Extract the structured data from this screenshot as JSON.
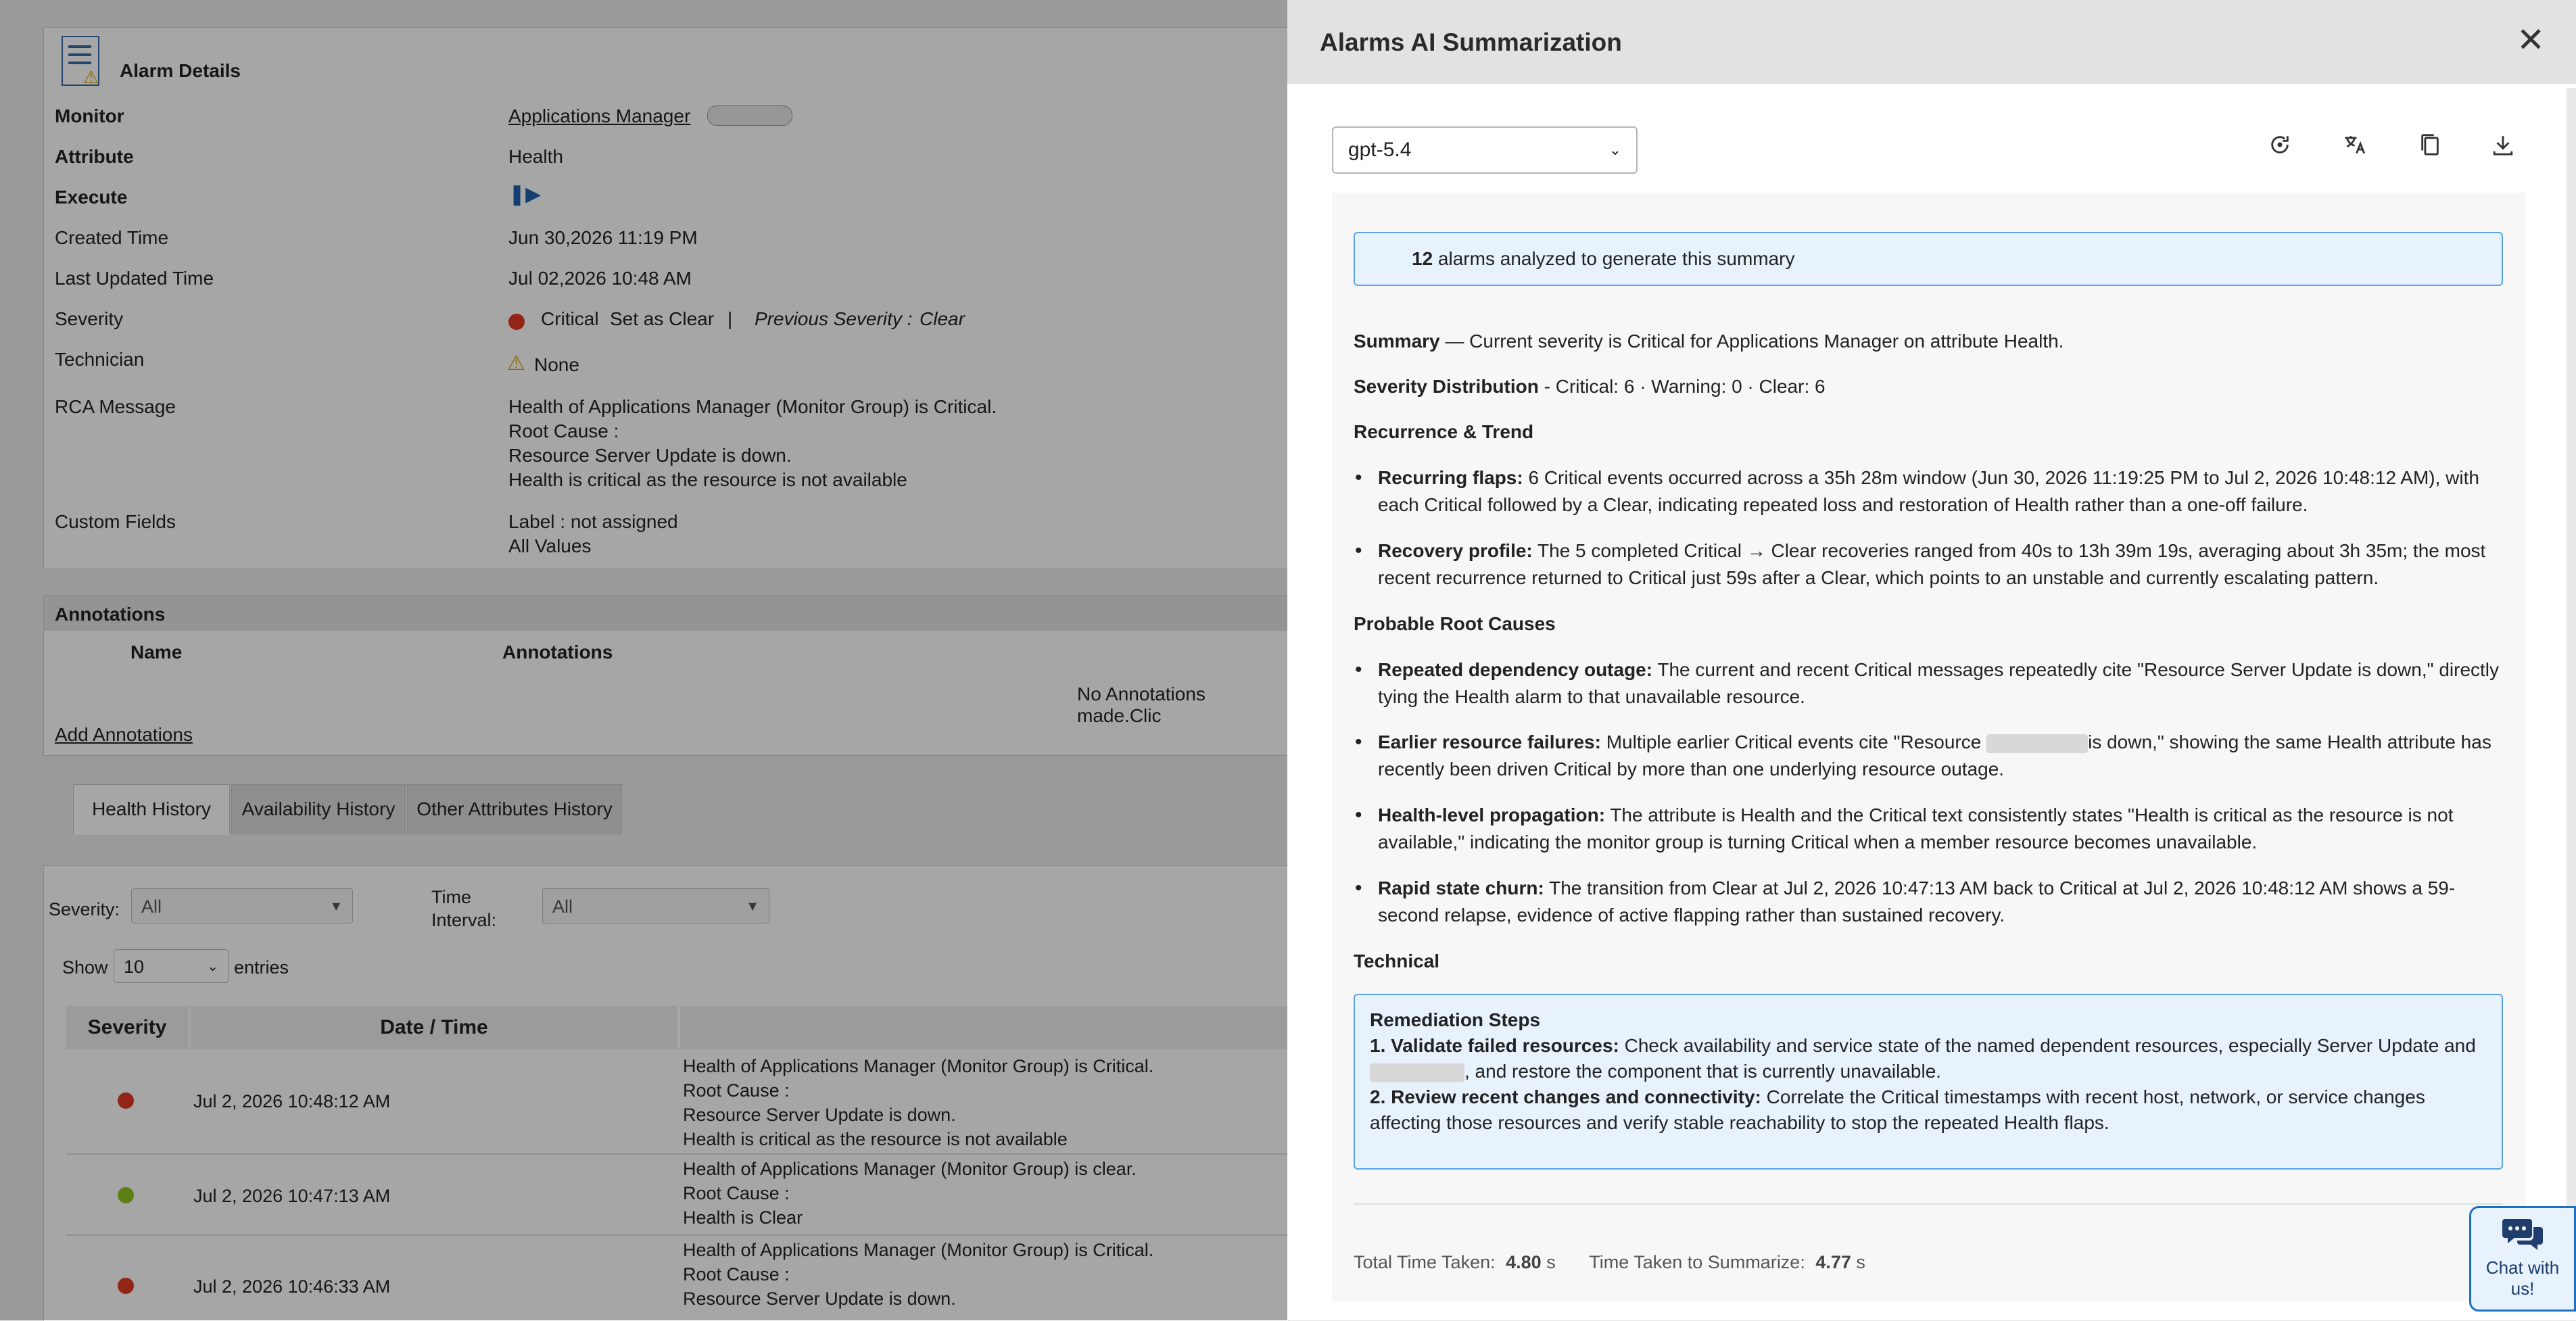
{
  "alarm": {
    "header_title": "Alarm Details",
    "rows": [
      {
        "label": "Monitor",
        "value": "Applications Manager "
      },
      {
        "label": "Attribute",
        "value": "Health"
      },
      {
        "label": "Execute",
        "value": ""
      },
      {
        "label": "Created  Time",
        "value": "Jun 30,2026 11:19 PM"
      },
      {
        "label": "Last Updated  Time",
        "value": "Jul 02,2026 10:48 AM"
      },
      {
        "label": "Severity",
        "value": "Critical"
      },
      {
        "label": "Technician",
        "value": "None"
      },
      {
        "label": "RCA Message",
        "value": ""
      },
      {
        "label": "Custom Fields",
        "value": ""
      }
    ],
    "set_as_clear": "Set as Clear",
    "separator": "|",
    "previous_severity_label": "Previous Severity :",
    "previous_severity_value": "Clear",
    "rca_lines": [
      "Health of Applications Manager (Monitor Group) is Critical.",
      "Root Cause :",
      "Resource Server Update is down.",
      "Health is critical as the resource is not available"
    ],
    "custom_lines": [
      "Label : not assigned",
      "All Values"
    ]
  },
  "annotations": {
    "title": "Annotations",
    "col_name": "Name",
    "col_annotations": "Annotations",
    "empty_text": "No Annotations made.Clic",
    "add_link": "Add Annotations"
  },
  "tabs": [
    "Health History",
    "Availability History",
    "Other Attributes History"
  ],
  "filters": {
    "severity_label": "Severity:",
    "severity_value": "All",
    "time_label_1": "Time",
    "time_label_2": "Interval:",
    "time_value": "All",
    "show_label": "Show",
    "show_value": "10",
    "entries_label": "entries"
  },
  "history": {
    "col_severity": "Severity",
    "col_datetime": "Date / Time",
    "rows": [
      {
        "severity": "critical",
        "datetime": "Jul 2, 2026 10:48:12 AM",
        "message": [
          "Health of Applications Manager (Monitor Group) is Critical.",
          "Root Cause :",
          "Resource Server Update is down.",
          "Health is critical as the resource is not available"
        ]
      },
      {
        "severity": "clear",
        "datetime": "Jul 2, 2026 10:47:13 AM",
        "message": [
          "Health of Applications Manager (Monitor Group) is clear.",
          "Root Cause :",
          "Health is Clear"
        ]
      },
      {
        "severity": "critical",
        "datetime": "Jul 2, 2026 10:46:33 AM",
        "message": [
          "Health of Applications Manager (Monitor Group) is Critical.",
          "Root Cause :",
          "Resource Server Update is down."
        ]
      }
    ]
  },
  "panel": {
    "title": "Alarms AI Summarization",
    "close_icon": "close-icon",
    "model": "gpt-5.4",
    "tools": [
      "refresh-icon",
      "translate-icon",
      "copy-icon",
      "download-icon"
    ],
    "info_count": "12",
    "info_text": " alarms analyzed to generate this summary",
    "summary_label": "Summary",
    "summary_text": " — Current severity is Critical for Applications Manager on attribute Health.",
    "dist_label": "Severity Distribution",
    "dist_text": " - Critical: 6 · Warning: 0 · Clear: 6",
    "recurrence_heading": "Recurrence & Trend",
    "flaps_label": "Recurring flaps:",
    "flaps_text": " 6 Critical events occurred across a 35h 28m window (Jun 30, 2026 11:19:25 PM to Jul 2, 2026 10:48:12 AM), with each Critical followed by a Clear, indicating repeated loss and restoration of Health rather than a one-off failure.",
    "recovery_label": "Recovery profile:",
    "recovery_text": " The 5 completed Critical → Clear recoveries ranged from 40s to 13h 39m 19s, averaging about 3h 35m; the most recent recurrence returned to Critical just 59s after a Clear, which points to an unstable and currently escalating pattern.",
    "rootcause_heading": "Probable Root Causes",
    "dep_label": "Repeated dependency outage:",
    "dep_text": " The current and recent Critical messages repeatedly cite \"Resource Server Update is down,\" directly tying the Health alarm to that unavailable resource.",
    "earlier_label": "Earlier resource failures:",
    "earlier_text_a": " Multiple earlier Critical events cite \"Resource ",
    "earlier_text_b": "is down,\" showing the same Health attribute has recently been driven Critical by more than one underlying resource outage.",
    "prop_label": "Health-level propagation:",
    "prop_text": " The attribute is Health and the Critical text consistently states \"Health is critical as the resource is not available,\" indicating the monitor group is turning Critical when a member resource becomes unavailable.",
    "churn_label": "Rapid state churn:",
    "churn_text": " The transition from Clear at Jul 2, 2026 10:47:13 AM back to Critical at Jul 2, 2026 10:48:12 AM shows a 59-second relapse, evidence of active flapping rather than sustained recovery.",
    "technical_heading": "Technical",
    "rem_title": "Remediation Steps",
    "rem1_label": "1. Validate failed resources:",
    "rem1_text_a": " Check availability and service state of the named dependent resources, especially Server Update and ",
    "rem1_text_b": ", and restore the component that is currently unavailable.",
    "rem2_label": "2. Review recent changes and connectivity:",
    "rem2_text": " Correlate the Critical timestamps with recent host, network, or service changes affecting those resources and verify stable reachability to stop the repeated Health flaps.",
    "total_label": "Total Time Taken:",
    "total_value": "4.80",
    "total_unit": " s",
    "sum_label": "Time Taken to Summarize:",
    "sum_value": "4.77",
    "sum_unit": " s",
    "chat_line1": "Chat with",
    "chat_line2": "us!"
  }
}
